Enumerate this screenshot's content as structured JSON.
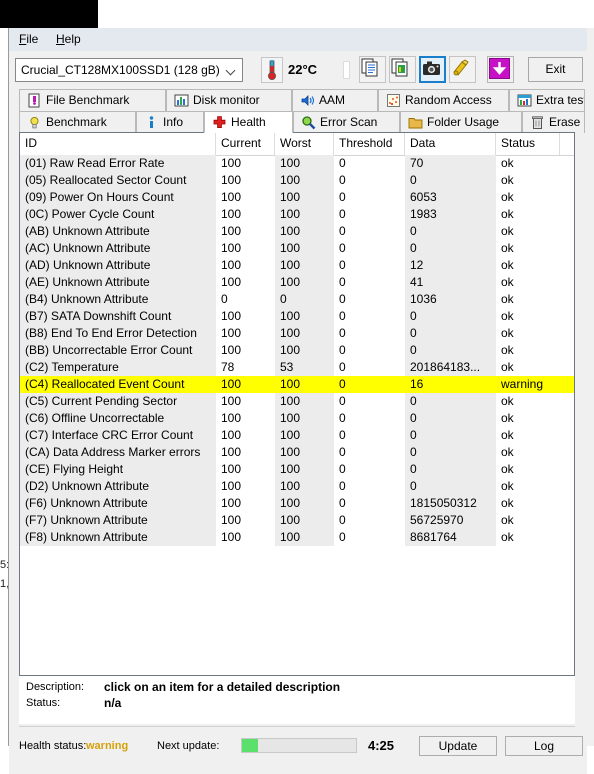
{
  "window": {
    "menu": [
      {
        "label": "File",
        "mnemonic": "F"
      },
      {
        "label": "Help",
        "mnemonic": "H"
      }
    ]
  },
  "toolbar": {
    "drive_select": {
      "value": "Crucial_CT128MX100SSD1 (128 gB)",
      "icon": "chevron-down-icon"
    },
    "temperature": "22°C",
    "thermometer_icon": "thermometer-icon",
    "buttons": [
      {
        "name": "copy-text-button",
        "icon": "copy-document-icon",
        "selected": false
      },
      {
        "name": "copy-image-button",
        "icon": "copy-image-icon",
        "selected": false
      },
      {
        "name": "screenshot-button",
        "icon": "camera-icon",
        "selected": true
      },
      {
        "name": "settings-button",
        "icon": "wrench-icon",
        "selected": false
      },
      {
        "name": "download-button",
        "icon": "download-arrow-icon",
        "selected": false
      }
    ],
    "exit_label": "Exit"
  },
  "tabs_row1": [
    {
      "label": "File Benchmark",
      "icon": "file-benchmark-icon",
      "active": false
    },
    {
      "label": "Disk monitor",
      "icon": "bar-chart-icon",
      "active": false
    },
    {
      "label": "AAM",
      "icon": "speaker-icon",
      "active": false
    },
    {
      "label": "Random Access",
      "icon": "scatter-icon",
      "active": false
    },
    {
      "label": "Extra tests",
      "icon": "calculator-chart-icon",
      "active": false
    }
  ],
  "tabs_row2": [
    {
      "label": "Benchmark",
      "icon": "lightbulb-icon",
      "active": false
    },
    {
      "label": "Info",
      "icon": "info-icon",
      "active": false
    },
    {
      "label": "Health",
      "icon": "red-cross-icon",
      "active": true
    },
    {
      "label": "Error Scan",
      "icon": "magnifier-icon",
      "active": false
    },
    {
      "label": "Folder Usage",
      "icon": "folder-icon",
      "active": false
    },
    {
      "label": "Erase",
      "icon": "trash-icon",
      "active": false
    }
  ],
  "table": {
    "columns": [
      "ID",
      "Current",
      "Worst",
      "Threshold",
      "Data",
      "Status"
    ],
    "rows": [
      {
        "id": "(01) Raw Read Error Rate",
        "current": "100",
        "worst": "100",
        "threshold": "0",
        "data": "70",
        "status": "ok",
        "warn": false
      },
      {
        "id": "(05) Reallocated Sector Count",
        "current": "100",
        "worst": "100",
        "threshold": "0",
        "data": "0",
        "status": "ok",
        "warn": false
      },
      {
        "id": "(09) Power On Hours Count",
        "current": "100",
        "worst": "100",
        "threshold": "0",
        "data": "6053",
        "status": "ok",
        "warn": false
      },
      {
        "id": "(0C) Power Cycle Count",
        "current": "100",
        "worst": "100",
        "threshold": "0",
        "data": "1983",
        "status": "ok",
        "warn": false
      },
      {
        "id": "(AB) Unknown Attribute",
        "current": "100",
        "worst": "100",
        "threshold": "0",
        "data": "0",
        "status": "ok",
        "warn": false
      },
      {
        "id": "(AC) Unknown Attribute",
        "current": "100",
        "worst": "100",
        "threshold": "0",
        "data": "0",
        "status": "ok",
        "warn": false
      },
      {
        "id": "(AD) Unknown Attribute",
        "current": "100",
        "worst": "100",
        "threshold": "0",
        "data": "12",
        "status": "ok",
        "warn": false
      },
      {
        "id": "(AE) Unknown Attribute",
        "current": "100",
        "worst": "100",
        "threshold": "0",
        "data": "41",
        "status": "ok",
        "warn": false
      },
      {
        "id": "(B4) Unknown Attribute",
        "current": "0",
        "worst": "0",
        "threshold": "0",
        "data": "1036",
        "status": "ok",
        "warn": false
      },
      {
        "id": "(B7) SATA Downshift Count",
        "current": "100",
        "worst": "100",
        "threshold": "0",
        "data": "0",
        "status": "ok",
        "warn": false
      },
      {
        "id": "(B8) End To End Error Detection",
        "current": "100",
        "worst": "100",
        "threshold": "0",
        "data": "0",
        "status": "ok",
        "warn": false
      },
      {
        "id": "(BB) Uncorrectable Error Count",
        "current": "100",
        "worst": "100",
        "threshold": "0",
        "data": "0",
        "status": "ok",
        "warn": false
      },
      {
        "id": "(C2) Temperature",
        "current": "78",
        "worst": "53",
        "threshold": "0",
        "data": "201864183...",
        "status": "ok",
        "warn": false
      },
      {
        "id": "(C4) Reallocated Event Count",
        "current": "100",
        "worst": "100",
        "threshold": "0",
        "data": "16",
        "status": "warning",
        "warn": true
      },
      {
        "id": "(C5) Current Pending Sector",
        "current": "100",
        "worst": "100",
        "threshold": "0",
        "data": "0",
        "status": "ok",
        "warn": false
      },
      {
        "id": "(C6) Offline Uncorrectable",
        "current": "100",
        "worst": "100",
        "threshold": "0",
        "data": "0",
        "status": "ok",
        "warn": false
      },
      {
        "id": "(C7) Interface CRC Error Count",
        "current": "100",
        "worst": "100",
        "threshold": "0",
        "data": "0",
        "status": "ok",
        "warn": false
      },
      {
        "id": "(CA) Data Address Marker errors",
        "current": "100",
        "worst": "100",
        "threshold": "0",
        "data": "0",
        "status": "ok",
        "warn": false
      },
      {
        "id": "(CE) Flying Height",
        "current": "100",
        "worst": "100",
        "threshold": "0",
        "data": "0",
        "status": "ok",
        "warn": false
      },
      {
        "id": "(D2) Unknown Attribute",
        "current": "100",
        "worst": "100",
        "threshold": "0",
        "data": "0",
        "status": "ok",
        "warn": false
      },
      {
        "id": "(F6) Unknown Attribute",
        "current": "100",
        "worst": "100",
        "threshold": "0",
        "data": "1815050312",
        "status": "ok",
        "warn": false
      },
      {
        "id": "(F7) Unknown Attribute",
        "current": "100",
        "worst": "100",
        "threshold": "0",
        "data": "56725970",
        "status": "ok",
        "warn": false
      },
      {
        "id": "(F8) Unknown Attribute",
        "current": "100",
        "worst": "100",
        "threshold": "0",
        "data": "8681764",
        "status": "ok",
        "warn": false
      }
    ]
  },
  "description_panel": {
    "description_label": "Description:",
    "description_value": "click on an item for a detailed description",
    "status_label": "Status:",
    "status_value": "n/a"
  },
  "statusbar": {
    "health_label": "Health status:",
    "health_value": "warning",
    "next_update_label": "Next update:",
    "progress_percent": 14,
    "time_remaining": "4:25",
    "update_label": "Update",
    "log_label": "Log"
  },
  "background_window": {
    "fragment_line1": "5:",
    "fragment_line2": "1,"
  },
  "colors": {
    "warning_row": "#ffff00",
    "warning_text": "#d4a10a",
    "progress_fill": "#5ae06b",
    "accent_selected": "#1a7ec8"
  }
}
